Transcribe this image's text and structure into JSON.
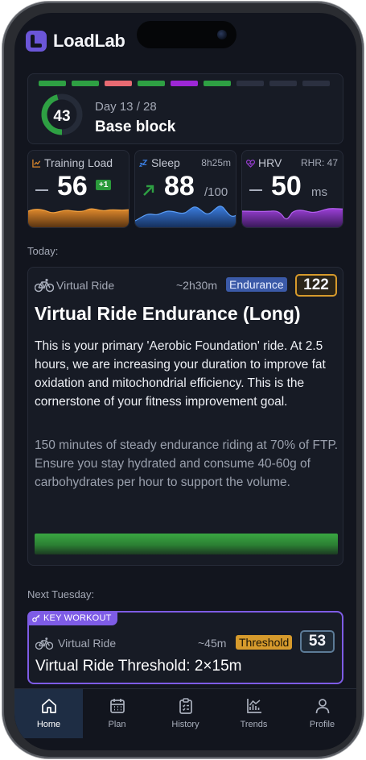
{
  "app": {
    "title": "LoadLab"
  },
  "block": {
    "score": "43",
    "score_fraction": 0.46,
    "day": "Day 13 / 28",
    "name": "Base block",
    "segments": [
      "#2ea043",
      "#2ea043",
      "#e86a72",
      "#2ea043",
      "#9d27d6",
      "#2ea043",
      "#2b3040",
      "#2b3040",
      "#2b3040"
    ]
  },
  "metrics": {
    "training_load": {
      "label": "Training Load",
      "value": "56",
      "badge": "+1",
      "icon": "chart-icon",
      "color": "#e08a2c"
    },
    "sleep": {
      "label": "Sleep",
      "duration": "8h25m",
      "value": "88",
      "unit": "/100",
      "icon": "zzz-icon",
      "color": "#3b7ee0"
    },
    "hrv": {
      "label": "HRV",
      "rhr": "RHR: 47",
      "value": "50",
      "unit": "ms",
      "icon": "heart-pulse-icon",
      "color": "#9b3fd6"
    }
  },
  "today": {
    "section_label": "Today:",
    "workout": {
      "type": "Virtual Ride",
      "duration": "~2h30m",
      "zone_tag": "Endurance",
      "tss": "122",
      "title": "Virtual Ride Endurance (Long)",
      "description": "This is your primary 'Aerobic Foundation' ride. At 2.5 hours, we are increasing your duration to improve fat oxidation and mitochondrial efficiency. This is the cornerstone of your fitness improvement goal.",
      "details": "150 minutes of steady endurance riding at 70% of FTP. Ensure you stay hydrated and consume 40-60g of carbohydrates per hour to support the volume."
    }
  },
  "next": {
    "section_label": "Next Tuesday:",
    "badge": "KEY WORKOUT",
    "workout": {
      "type": "Virtual Ride",
      "duration": "~45m",
      "zone_tag": "Threshold",
      "tss": "53",
      "title": "Virtual Ride Threshold: 2×15m"
    }
  },
  "nav": {
    "items": [
      {
        "label": "Home",
        "icon": "home-icon",
        "active": true
      },
      {
        "label": "Plan",
        "icon": "calendar-icon",
        "active": false
      },
      {
        "label": "History",
        "icon": "clipboard-icon",
        "active": false
      },
      {
        "label": "Trends",
        "icon": "trend-chart-icon",
        "active": false
      },
      {
        "label": "Profile",
        "icon": "user-icon",
        "active": false
      }
    ]
  }
}
